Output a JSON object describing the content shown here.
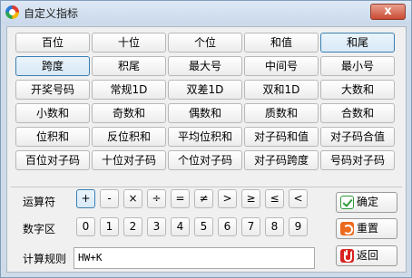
{
  "window": {
    "title": "自定义指标",
    "close_label": "x"
  },
  "grid": {
    "rows": [
      [
        "百位",
        "十位",
        "个位",
        "和值",
        "和尾"
      ],
      [
        "跨度",
        "积尾",
        "最大号",
        "中间号",
        "最小号"
      ],
      [
        "开奖号码",
        "常规1D",
        "双差1D",
        "双和1D",
        "大数和"
      ],
      [
        "小数和",
        "奇数和",
        "偶数和",
        "质数和",
        "合数和"
      ],
      [
        "位积和",
        "反位积和",
        "平均位积和",
        "对子码和值",
        "对子码合值"
      ],
      [
        "百位对子码",
        "十位对子码",
        "个位对子码",
        "对子码跨度",
        "号码对子码"
      ]
    ],
    "selected": [
      "和尾",
      "跨度"
    ]
  },
  "operators": {
    "label": "运算符",
    "items": [
      "+",
      "-",
      "×",
      "÷",
      "=",
      "≠",
      ">",
      "≥",
      "≤",
      "<"
    ],
    "selected": "+"
  },
  "digits": {
    "label": "数字区",
    "items": [
      "0",
      "1",
      "2",
      "3",
      "4",
      "5",
      "6",
      "7",
      "8",
      "9"
    ]
  },
  "rule": {
    "label": "计算规则",
    "value": "HW+K"
  },
  "actions": {
    "confirm": "确定",
    "reset": "重置",
    "back": "返回"
  }
}
